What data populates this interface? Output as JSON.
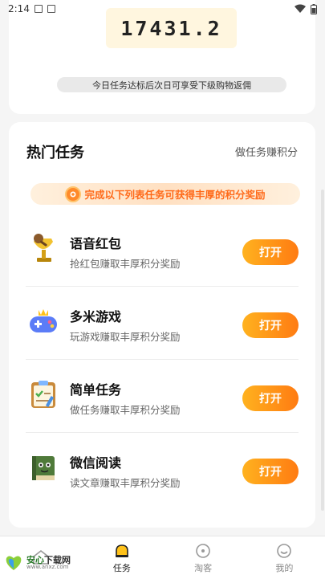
{
  "status_bar": {
    "time": "2:14"
  },
  "points": {
    "value": "17431.2"
  },
  "notice": {
    "text": "今日任务达标后次日可享受下级购物返佣"
  },
  "tasks": {
    "title": "热门任务",
    "subtitle": "做任务赚积分",
    "banner": "完成以下列表任务可获得丰厚的积分奖励",
    "items": [
      {
        "name": "语音红包",
        "desc": "抢红包赚取丰厚积分奖励",
        "button": "打开",
        "icon": "microphone-trophy-icon"
      },
      {
        "name": "多米游戏",
        "desc": "玩游戏赚取丰厚积分奖励",
        "button": "打开",
        "icon": "gamepad-icon"
      },
      {
        "name": "简单任务",
        "desc": "做任务赚取丰厚积分奖励",
        "button": "打开",
        "icon": "checklist-icon"
      },
      {
        "name": "微信阅读",
        "desc": "读文章赚取丰厚积分奖励",
        "button": "打开",
        "icon": "book-icon"
      }
    ]
  },
  "nav": {
    "items": [
      {
        "label": "",
        "icon": "home-icon"
      },
      {
        "label": "任务",
        "icon": "task-icon",
        "active": true
      },
      {
        "label": "淘客",
        "icon": "taoke-icon"
      },
      {
        "label": "我的",
        "icon": "profile-icon"
      }
    ]
  },
  "watermark": {
    "title_a": "安心",
    "title_b": "下载网",
    "url": "www.anxz.com"
  },
  "colors": {
    "accent": "#ff7b12",
    "accent_light": "#ffb21f",
    "banner_text": "#ff6a1a"
  }
}
